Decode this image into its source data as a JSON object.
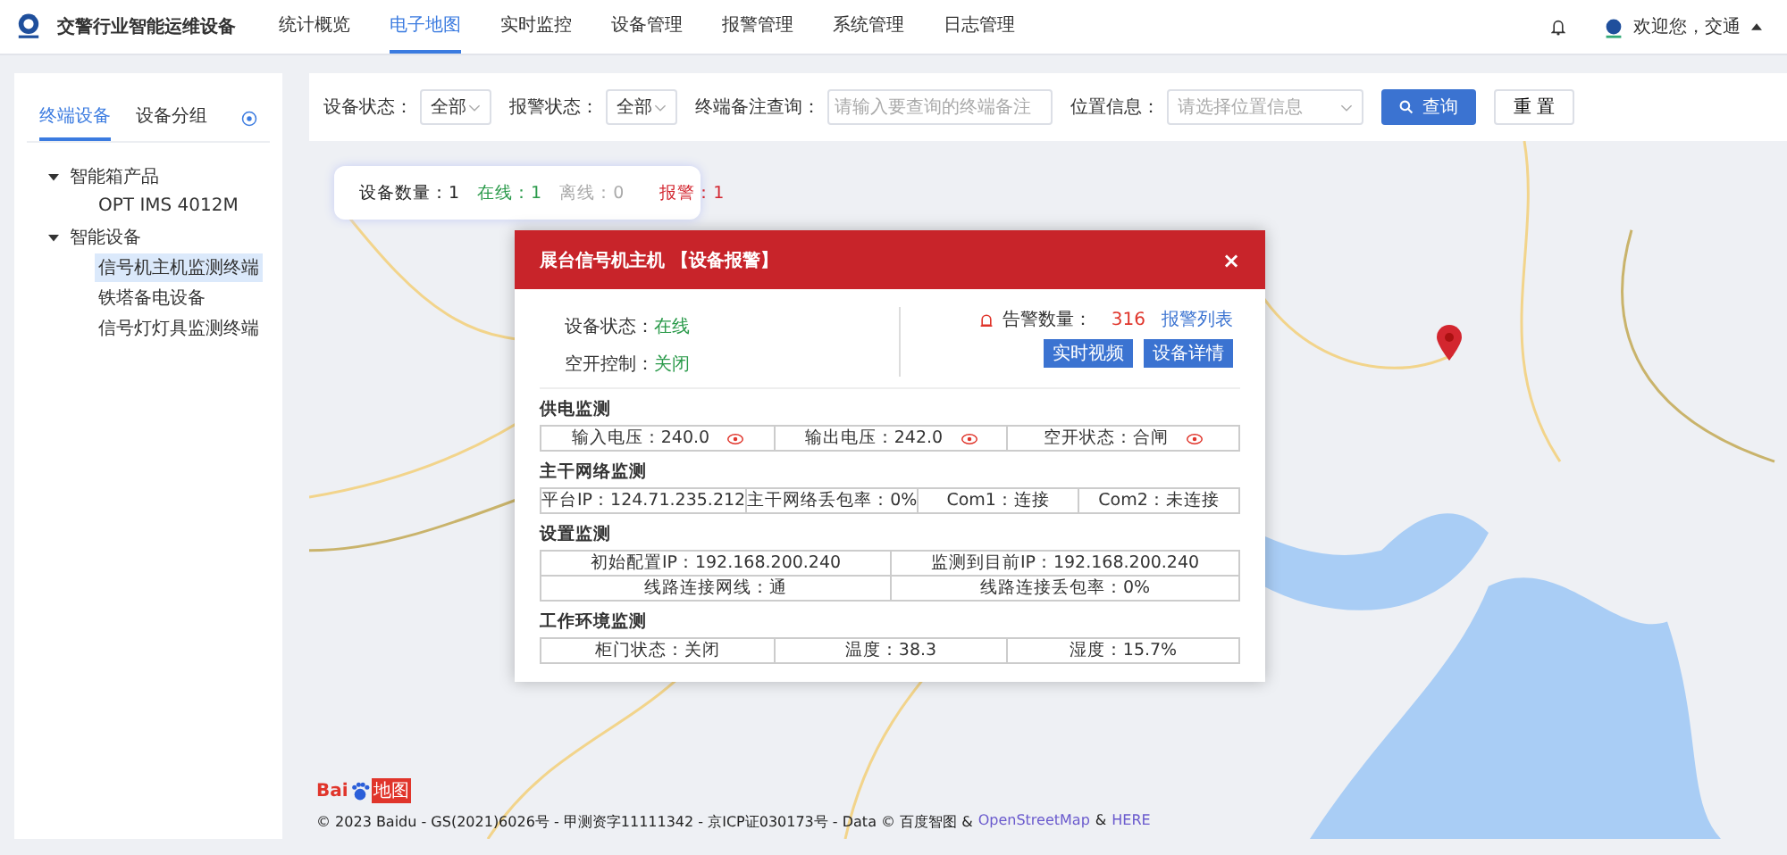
{
  "app": {
    "title": "交警行业智能运维设备"
  },
  "nav": [
    {
      "label": "统计概览",
      "selected": false
    },
    {
      "label": "电子地图",
      "selected": true
    },
    {
      "label": "实时监控",
      "selected": false
    },
    {
      "label": "设备管理",
      "selected": false
    },
    {
      "label": "报警管理",
      "selected": false
    },
    {
      "label": "系统管理",
      "selected": false
    },
    {
      "label": "日志管理",
      "selected": false
    }
  ],
  "user": {
    "greeting": "欢迎您，交通"
  },
  "sidebar": {
    "tabs": [
      {
        "label": "终端设备",
        "selected": true
      },
      {
        "label": "设备分组",
        "selected": false
      }
    ],
    "tree": [
      {
        "label": "智能箱产品",
        "expanded": true,
        "children": [
          {
            "label": "OPT IMS 4012M",
            "selected": false
          }
        ]
      },
      {
        "label": "智能设备",
        "expanded": true,
        "children": [
          {
            "label": "信号机主机监测终端",
            "selected": true
          },
          {
            "label": "铁塔备电设备",
            "selected": false
          },
          {
            "label": "信号灯灯具监测终端",
            "selected": false
          }
        ]
      }
    ]
  },
  "filters": [
    {
      "kind": "select",
      "label": "设备状态：",
      "value": "全部"
    },
    {
      "kind": "select",
      "label": "报警状态：",
      "value": "全部"
    },
    {
      "kind": "input",
      "label": "终端备注查询：",
      "placeholder": "请输入要查询的终端备注"
    },
    {
      "kind": "select",
      "label": "位置信息：",
      "placeholder": "请选择位置信息"
    }
  ],
  "search_button": "查询",
  "reset_button": "重 置",
  "stats": [
    {
      "kind": "total",
      "label": "设备数量：",
      "value": "1"
    },
    {
      "kind": "online",
      "label": "在线：",
      "value": "1"
    },
    {
      "kind": "offline",
      "label": "离线：",
      "value": "0"
    },
    {
      "kind": "alarm",
      "label": "报警：",
      "value": "1"
    }
  ],
  "popup": {
    "title": "展台信号机主机 【设备报警】",
    "close": "×",
    "status": [
      {
        "label": "设备状态：",
        "value": "在线"
      },
      {
        "label": "空开控制：",
        "value": "关闭"
      }
    ],
    "alarm": {
      "label": "告警数量：",
      "count": "316",
      "link": "报警列表"
    },
    "buttons": [
      "实时视频",
      "设备详情"
    ],
    "sections": [
      {
        "title": "供电监测",
        "rows": [
          [
            {
              "text": "输入电压：240.0",
              "alert": true
            },
            {
              "text": "输出电压：242.0",
              "alert": true
            },
            {
              "text": "空开状态：合闸",
              "alert": true
            }
          ]
        ]
      },
      {
        "title": "主干网络监测",
        "rows": [
          [
            {
              "text": "平台IP：124.71.235.212",
              "alert": false
            },
            {
              "text": "主干网络丢包率：0%",
              "alert": false
            },
            {
              "text": "Com1：连接",
              "alert": false
            },
            {
              "text": "Com2：未连接",
              "alert": false
            }
          ]
        ]
      },
      {
        "title": "设置监测",
        "rows": [
          [
            {
              "text": "初始配置IP：192.168.200.240",
              "alert": false
            },
            {
              "text": "监测到目前IP：192.168.200.240",
              "alert": false
            }
          ],
          [
            {
              "text": "线路连接网线：通",
              "alert": false
            },
            {
              "text": "线路连接丢包率：0%",
              "alert": false
            }
          ]
        ]
      },
      {
        "title": "工作环境监测",
        "rows": [
          [
            {
              "text": "柜门状态：关闭",
              "alert": false
            },
            {
              "text": "温度：38.3",
              "alert": false
            },
            {
              "text": "湿度：15.7%",
              "alert": false
            }
          ]
        ]
      }
    ]
  },
  "map_logo": {
    "left": "Bai",
    "right": "地图"
  },
  "attribution": [
    {
      "kind": "text",
      "text": "© 2023 Baidu - GS(2021)6026号 - 甲测资字11111342 - 京ICP证030173号 - Data © 百度智图 &"
    },
    {
      "kind": "link",
      "text": "OpenStreetMap"
    },
    {
      "kind": "text",
      "text": "&"
    },
    {
      "kind": "link",
      "text": "HERE"
    }
  ]
}
